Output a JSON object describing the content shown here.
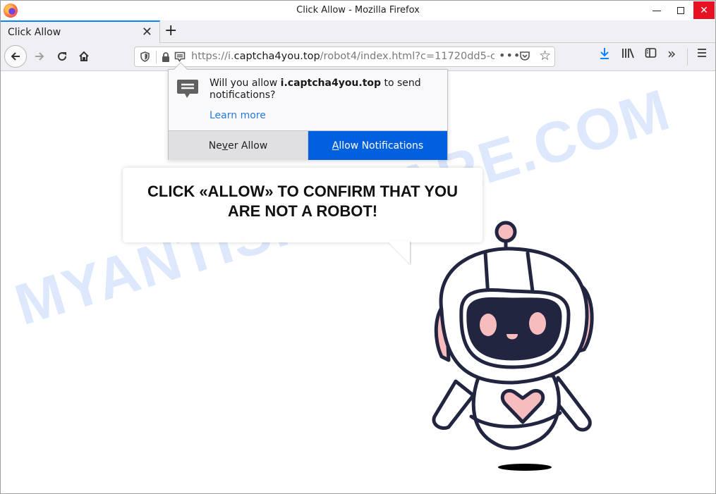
{
  "window": {
    "title": "Click Allow - Mozilla Firefox"
  },
  "tabs": [
    {
      "label": "Click Allow",
      "active": true
    }
  ],
  "urlbar": {
    "scheme": "https://i.",
    "host": "captcha4you.top",
    "path": "/robot4/index.html?c=11720dd5-c",
    "more_glyph": "•••"
  },
  "notification_prompt": {
    "message_prefix": "Will you allow ",
    "site": "i.captcha4you.top",
    "message_suffix": " to send notifications?",
    "learn_more": "Learn more",
    "never_allow": {
      "before": "Ne",
      "accel": "v",
      "after": "er Allow"
    },
    "allow": {
      "before": "",
      "accel": "A",
      "after": "llow Notifications"
    }
  },
  "page": {
    "headline": "CLICK «ALLOW» TO CONFIRM THAT YOU ARE NOT A ROBOT!",
    "watermark": "MYANTISPYWARE.COM"
  },
  "colors": {
    "allow_button": "#0060df",
    "close_button": "#e81123",
    "robot_outline": "#22253f",
    "robot_pink": "#f7bcbd",
    "download_icon": "#0a84ff"
  }
}
